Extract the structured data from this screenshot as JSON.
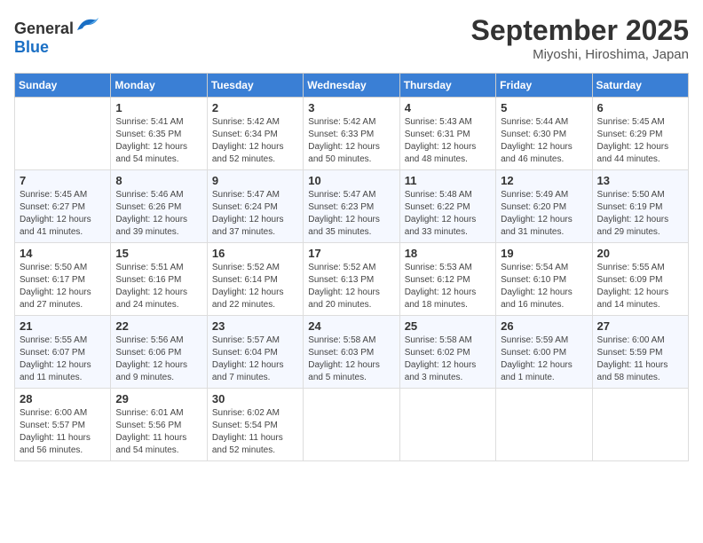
{
  "header": {
    "logo_general": "General",
    "logo_blue": "Blue",
    "month_title": "September 2025",
    "location": "Miyoshi, Hiroshima, Japan"
  },
  "days_of_week": [
    "Sunday",
    "Monday",
    "Tuesday",
    "Wednesday",
    "Thursday",
    "Friday",
    "Saturday"
  ],
  "weeks": [
    [
      {
        "day": "",
        "sunrise": "",
        "sunset": "",
        "daylight": ""
      },
      {
        "day": "1",
        "sunrise": "Sunrise: 5:41 AM",
        "sunset": "Sunset: 6:35 PM",
        "daylight": "Daylight: 12 hours and 54 minutes."
      },
      {
        "day": "2",
        "sunrise": "Sunrise: 5:42 AM",
        "sunset": "Sunset: 6:34 PM",
        "daylight": "Daylight: 12 hours and 52 minutes."
      },
      {
        "day": "3",
        "sunrise": "Sunrise: 5:42 AM",
        "sunset": "Sunset: 6:33 PM",
        "daylight": "Daylight: 12 hours and 50 minutes."
      },
      {
        "day": "4",
        "sunrise": "Sunrise: 5:43 AM",
        "sunset": "Sunset: 6:31 PM",
        "daylight": "Daylight: 12 hours and 48 minutes."
      },
      {
        "day": "5",
        "sunrise": "Sunrise: 5:44 AM",
        "sunset": "Sunset: 6:30 PM",
        "daylight": "Daylight: 12 hours and 46 minutes."
      },
      {
        "day": "6",
        "sunrise": "Sunrise: 5:45 AM",
        "sunset": "Sunset: 6:29 PM",
        "daylight": "Daylight: 12 hours and 44 minutes."
      }
    ],
    [
      {
        "day": "7",
        "sunrise": "Sunrise: 5:45 AM",
        "sunset": "Sunset: 6:27 PM",
        "daylight": "Daylight: 12 hours and 41 minutes."
      },
      {
        "day": "8",
        "sunrise": "Sunrise: 5:46 AM",
        "sunset": "Sunset: 6:26 PM",
        "daylight": "Daylight: 12 hours and 39 minutes."
      },
      {
        "day": "9",
        "sunrise": "Sunrise: 5:47 AM",
        "sunset": "Sunset: 6:24 PM",
        "daylight": "Daylight: 12 hours and 37 minutes."
      },
      {
        "day": "10",
        "sunrise": "Sunrise: 5:47 AM",
        "sunset": "Sunset: 6:23 PM",
        "daylight": "Daylight: 12 hours and 35 minutes."
      },
      {
        "day": "11",
        "sunrise": "Sunrise: 5:48 AM",
        "sunset": "Sunset: 6:22 PM",
        "daylight": "Daylight: 12 hours and 33 minutes."
      },
      {
        "day": "12",
        "sunrise": "Sunrise: 5:49 AM",
        "sunset": "Sunset: 6:20 PM",
        "daylight": "Daylight: 12 hours and 31 minutes."
      },
      {
        "day": "13",
        "sunrise": "Sunrise: 5:50 AM",
        "sunset": "Sunset: 6:19 PM",
        "daylight": "Daylight: 12 hours and 29 minutes."
      }
    ],
    [
      {
        "day": "14",
        "sunrise": "Sunrise: 5:50 AM",
        "sunset": "Sunset: 6:17 PM",
        "daylight": "Daylight: 12 hours and 27 minutes."
      },
      {
        "day": "15",
        "sunrise": "Sunrise: 5:51 AM",
        "sunset": "Sunset: 6:16 PM",
        "daylight": "Daylight: 12 hours and 24 minutes."
      },
      {
        "day": "16",
        "sunrise": "Sunrise: 5:52 AM",
        "sunset": "Sunset: 6:14 PM",
        "daylight": "Daylight: 12 hours and 22 minutes."
      },
      {
        "day": "17",
        "sunrise": "Sunrise: 5:52 AM",
        "sunset": "Sunset: 6:13 PM",
        "daylight": "Daylight: 12 hours and 20 minutes."
      },
      {
        "day": "18",
        "sunrise": "Sunrise: 5:53 AM",
        "sunset": "Sunset: 6:12 PM",
        "daylight": "Daylight: 12 hours and 18 minutes."
      },
      {
        "day": "19",
        "sunrise": "Sunrise: 5:54 AM",
        "sunset": "Sunset: 6:10 PM",
        "daylight": "Daylight: 12 hours and 16 minutes."
      },
      {
        "day": "20",
        "sunrise": "Sunrise: 5:55 AM",
        "sunset": "Sunset: 6:09 PM",
        "daylight": "Daylight: 12 hours and 14 minutes."
      }
    ],
    [
      {
        "day": "21",
        "sunrise": "Sunrise: 5:55 AM",
        "sunset": "Sunset: 6:07 PM",
        "daylight": "Daylight: 12 hours and 11 minutes."
      },
      {
        "day": "22",
        "sunrise": "Sunrise: 5:56 AM",
        "sunset": "Sunset: 6:06 PM",
        "daylight": "Daylight: 12 hours and 9 minutes."
      },
      {
        "day": "23",
        "sunrise": "Sunrise: 5:57 AM",
        "sunset": "Sunset: 6:04 PM",
        "daylight": "Daylight: 12 hours and 7 minutes."
      },
      {
        "day": "24",
        "sunrise": "Sunrise: 5:58 AM",
        "sunset": "Sunset: 6:03 PM",
        "daylight": "Daylight: 12 hours and 5 minutes."
      },
      {
        "day": "25",
        "sunrise": "Sunrise: 5:58 AM",
        "sunset": "Sunset: 6:02 PM",
        "daylight": "Daylight: 12 hours and 3 minutes."
      },
      {
        "day": "26",
        "sunrise": "Sunrise: 5:59 AM",
        "sunset": "Sunset: 6:00 PM",
        "daylight": "Daylight: 12 hours and 1 minute."
      },
      {
        "day": "27",
        "sunrise": "Sunrise: 6:00 AM",
        "sunset": "Sunset: 5:59 PM",
        "daylight": "Daylight: 11 hours and 58 minutes."
      }
    ],
    [
      {
        "day": "28",
        "sunrise": "Sunrise: 6:00 AM",
        "sunset": "Sunset: 5:57 PM",
        "daylight": "Daylight: 11 hours and 56 minutes."
      },
      {
        "day": "29",
        "sunrise": "Sunrise: 6:01 AM",
        "sunset": "Sunset: 5:56 PM",
        "daylight": "Daylight: 11 hours and 54 minutes."
      },
      {
        "day": "30",
        "sunrise": "Sunrise: 6:02 AM",
        "sunset": "Sunset: 5:54 PM",
        "daylight": "Daylight: 11 hours and 52 minutes."
      },
      {
        "day": "",
        "sunrise": "",
        "sunset": "",
        "daylight": ""
      },
      {
        "day": "",
        "sunrise": "",
        "sunset": "",
        "daylight": ""
      },
      {
        "day": "",
        "sunrise": "",
        "sunset": "",
        "daylight": ""
      },
      {
        "day": "",
        "sunrise": "",
        "sunset": "",
        "daylight": ""
      }
    ]
  ]
}
